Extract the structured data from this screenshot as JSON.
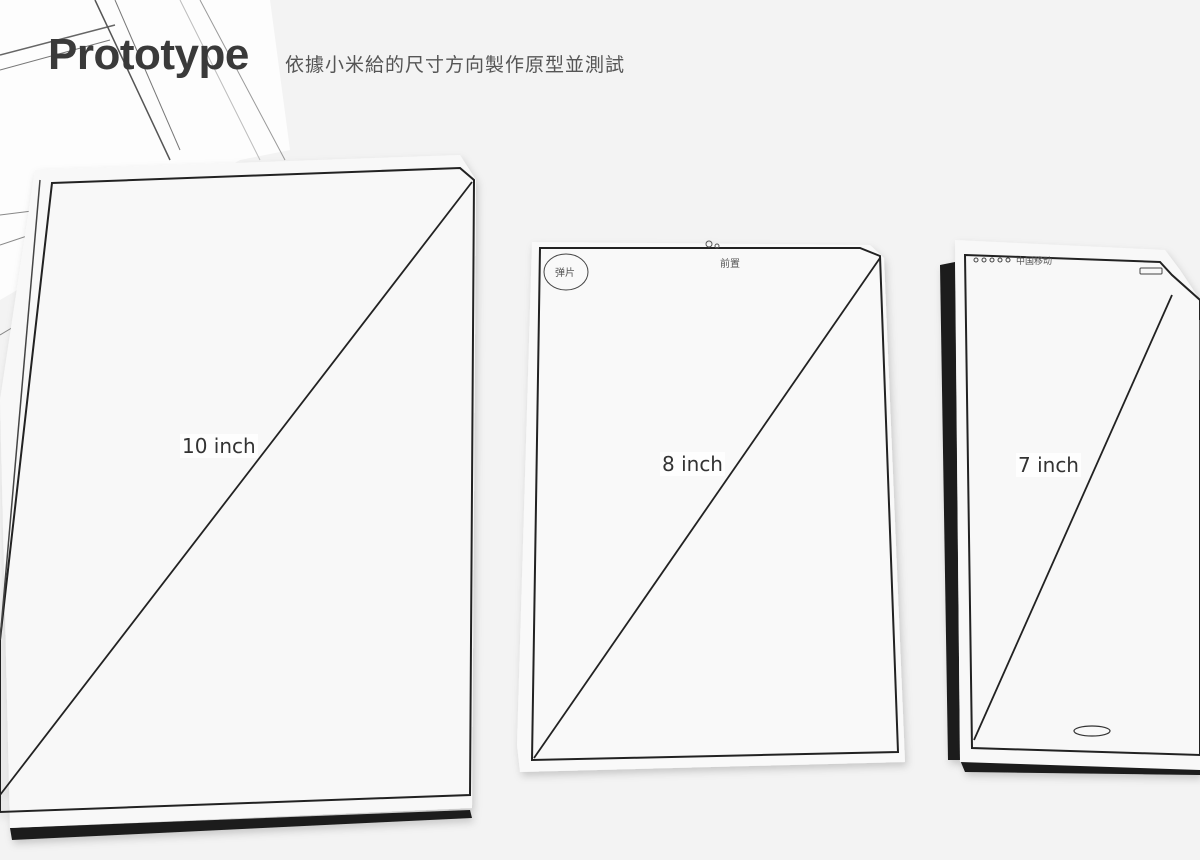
{
  "header": {
    "title": "Prototype",
    "subtitle": "依據小米給的尺寸方向製作原型並測試"
  },
  "prototypes": [
    {
      "size_label": "10 inch"
    },
    {
      "size_label": "8 inch",
      "handwritten_notes": [
        "弹片",
        "前置"
      ]
    },
    {
      "size_label": "7 inch",
      "handwritten_notes": [
        "中国移动"
      ]
    }
  ],
  "colors": {
    "background": "#f3f3f3",
    "paper": "#fafafa",
    "outline": "#222222",
    "title_text": "#3a3a3a"
  }
}
